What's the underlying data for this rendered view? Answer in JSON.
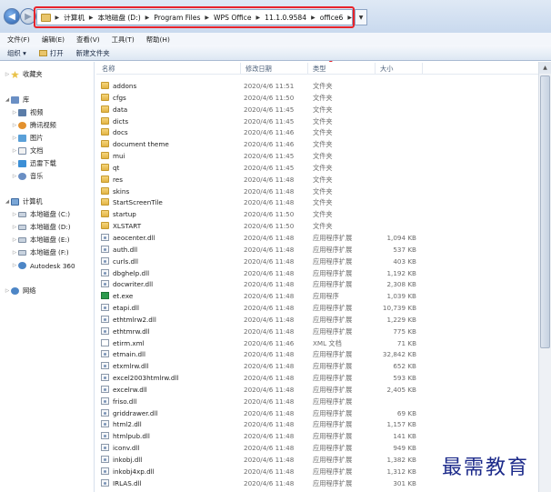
{
  "address": {
    "crumbs": [
      "计算机",
      "本地磁盘 (D:)",
      "Program Files",
      "WPS Office",
      "11.1.0.9584",
      "office6"
    ]
  },
  "menu": [
    "文件(F)",
    "编辑(E)",
    "查看(V)",
    "工具(T)",
    "帮助(H)"
  ],
  "toolbar": {
    "organize": "组织 ▾",
    "open": "打开",
    "new_folder": "新建文件夹"
  },
  "sidebar": {
    "favorites": "收藏夹",
    "library": "库",
    "lib_items": [
      "视频",
      "腾讯视频",
      "图片",
      "文档",
      "迅雷下载",
      "音乐"
    ],
    "computer": "计算机",
    "drives": [
      "本地磁盘 (C:)",
      "本地磁盘 (D:)",
      "本地磁盘 (E:)",
      "本地磁盘 (F:)",
      "Autodesk 360"
    ],
    "network": "网络"
  },
  "columns": {
    "name": "名称",
    "date": "修改日期",
    "type": "类型",
    "size": "大小"
  },
  "files": [
    {
      "name": "addons",
      "date": "2020/4/6 11:51",
      "type": "文件夹",
      "size": "",
      "kind": "folder"
    },
    {
      "name": "cfgs",
      "date": "2020/4/6 11:50",
      "type": "文件夹",
      "size": "",
      "kind": "folder"
    },
    {
      "name": "data",
      "date": "2020/4/6 11:45",
      "type": "文件夹",
      "size": "",
      "kind": "folder"
    },
    {
      "name": "dicts",
      "date": "2020/4/6 11:45",
      "type": "文件夹",
      "size": "",
      "kind": "folder"
    },
    {
      "name": "docs",
      "date": "2020/4/6 11:46",
      "type": "文件夹",
      "size": "",
      "kind": "folder"
    },
    {
      "name": "document theme",
      "date": "2020/4/6 11:46",
      "type": "文件夹",
      "size": "",
      "kind": "folder"
    },
    {
      "name": "mui",
      "date": "2020/4/6 11:45",
      "type": "文件夹",
      "size": "",
      "kind": "folder"
    },
    {
      "name": "qt",
      "date": "2020/4/6 11:45",
      "type": "文件夹",
      "size": "",
      "kind": "folder"
    },
    {
      "name": "res",
      "date": "2020/4/6 11:48",
      "type": "文件夹",
      "size": "",
      "kind": "folder"
    },
    {
      "name": "skins",
      "date": "2020/4/6 11:48",
      "type": "文件夹",
      "size": "",
      "kind": "folder"
    },
    {
      "name": "StartScreenTile",
      "date": "2020/4/6 11:48",
      "type": "文件夹",
      "size": "",
      "kind": "folder"
    },
    {
      "name": "startup",
      "date": "2020/4/6 11:50",
      "type": "文件夹",
      "size": "",
      "kind": "folder"
    },
    {
      "name": "XLSTART",
      "date": "2020/4/6 11:50",
      "type": "文件夹",
      "size": "",
      "kind": "folder"
    },
    {
      "name": "aeocenter.dll",
      "date": "2020/4/6 11:48",
      "type": "应用程序扩展",
      "size": "1,094 KB",
      "kind": "dll"
    },
    {
      "name": "auth.dll",
      "date": "2020/4/6 11:48",
      "type": "应用程序扩展",
      "size": "537 KB",
      "kind": "dll"
    },
    {
      "name": "curls.dll",
      "date": "2020/4/6 11:48",
      "type": "应用程序扩展",
      "size": "403 KB",
      "kind": "dll"
    },
    {
      "name": "dbghelp.dll",
      "date": "2020/4/6 11:48",
      "type": "应用程序扩展",
      "size": "1,192 KB",
      "kind": "dll"
    },
    {
      "name": "docwriter.dll",
      "date": "2020/4/6 11:48",
      "type": "应用程序扩展",
      "size": "2,308 KB",
      "kind": "dll"
    },
    {
      "name": "et.exe",
      "date": "2020/4/6 11:48",
      "type": "应用程序",
      "size": "1,039 KB",
      "kind": "exe"
    },
    {
      "name": "etapi.dll",
      "date": "2020/4/6 11:48",
      "type": "应用程序扩展",
      "size": "10,739 KB",
      "kind": "dll"
    },
    {
      "name": "ethtmlrw2.dll",
      "date": "2020/4/6 11:48",
      "type": "应用程序扩展",
      "size": "1,229 KB",
      "kind": "dll"
    },
    {
      "name": "ethtmrw.dll",
      "date": "2020/4/6 11:48",
      "type": "应用程序扩展",
      "size": "775 KB",
      "kind": "dll"
    },
    {
      "name": "etirm.xml",
      "date": "2020/4/6 11:46",
      "type": "XML 文档",
      "size": "71 KB",
      "kind": "xml"
    },
    {
      "name": "etmain.dll",
      "date": "2020/4/6 11:48",
      "type": "应用程序扩展",
      "size": "32,842 KB",
      "kind": "dll"
    },
    {
      "name": "etxmlrw.dll",
      "date": "2020/4/6 11:48",
      "type": "应用程序扩展",
      "size": "652 KB",
      "kind": "dll"
    },
    {
      "name": "excel2003htmlrw.dll",
      "date": "2020/4/6 11:48",
      "type": "应用程序扩展",
      "size": "593 KB",
      "kind": "dll"
    },
    {
      "name": "excelrw.dll",
      "date": "2020/4/6 11:48",
      "type": "应用程序扩展",
      "size": "2,405 KB",
      "kind": "dll"
    },
    {
      "name": "friso.dll",
      "date": "2020/4/6 11:48",
      "type": "应用程序扩展",
      "size": "",
      "kind": "dll"
    },
    {
      "name": "griddrawer.dll",
      "date": "2020/4/6 11:48",
      "type": "应用程序扩展",
      "size": "69 KB",
      "kind": "dll"
    },
    {
      "name": "html2.dll",
      "date": "2020/4/6 11:48",
      "type": "应用程序扩展",
      "size": "1,157 KB",
      "kind": "dll"
    },
    {
      "name": "htmlpub.dll",
      "date": "2020/4/6 11:48",
      "type": "应用程序扩展",
      "size": "141 KB",
      "kind": "dll"
    },
    {
      "name": "iconv.dll",
      "date": "2020/4/6 11:48",
      "type": "应用程序扩展",
      "size": "949 KB",
      "kind": "dll"
    },
    {
      "name": "inkobj.dll",
      "date": "2020/4/6 11:48",
      "type": "应用程序扩展",
      "size": "1,382 KB",
      "kind": "dll"
    },
    {
      "name": "inkobj4xp.dll",
      "date": "2020/4/6 11:48",
      "type": "应用程序扩展",
      "size": "1,312 KB",
      "kind": "dll"
    },
    {
      "name": "IRLAS.dll",
      "date": "2020/4/6 11:48",
      "type": "应用程序扩展",
      "size": "301 KB",
      "kind": "dll"
    }
  ],
  "watermark": "最需教育",
  "colors": {
    "highlight": "#e8232b",
    "watermark": "#1c2a8a"
  }
}
